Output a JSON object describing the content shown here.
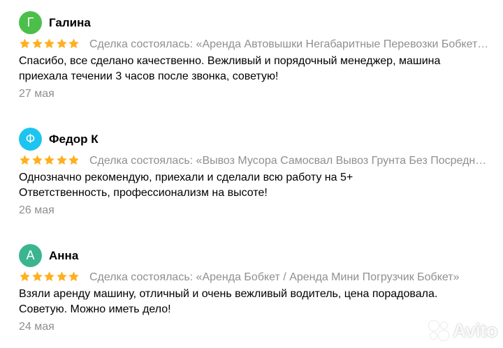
{
  "reviews": [
    {
      "avatar_letter": "Г",
      "avatar_color": "#4cbf4b",
      "author": "Галина",
      "rating": 5,
      "deal": "Сделка состоялась: «Аренда Автовышки Негабаритные Перевозки Бобкет Трал»",
      "text_line1": "Спасибо, все сделано качественно. Вежливый и порядочный менеджер, машина",
      "text_line2": "приехала течении 3 часов после звонка, советую!",
      "date": "27 мая"
    },
    {
      "avatar_letter": "Ф",
      "avatar_color": "#1ec4f0",
      "author": "Федор К",
      "rating": 5,
      "deal": "Сделка состоялась: «Вывоз Мусора Самосвал Вывоз Грунта Без Посредников»",
      "text_line1": "Однозначно рекомендую, приехали и сделали всю работу на 5+",
      "text_line2": "Ответственность, профессионализм на высоте!",
      "date": "26 мая"
    },
    {
      "avatar_letter": "А",
      "avatar_color": "#3bb58f",
      "author": "Анна",
      "rating": 5,
      "deal": "Сделка состоялась: «Аренда Бобкет / Аренда Мини Погрузчик Бобкет»",
      "text_line1": "Взяли аренду машину, отличный и очень вежливый водитель, цена порадовала.",
      "text_line2": "Советую. Можно иметь дело!",
      "date": "24 мая"
    }
  ],
  "star_color": "#ffb021",
  "watermark": {
    "text": "Avito"
  }
}
